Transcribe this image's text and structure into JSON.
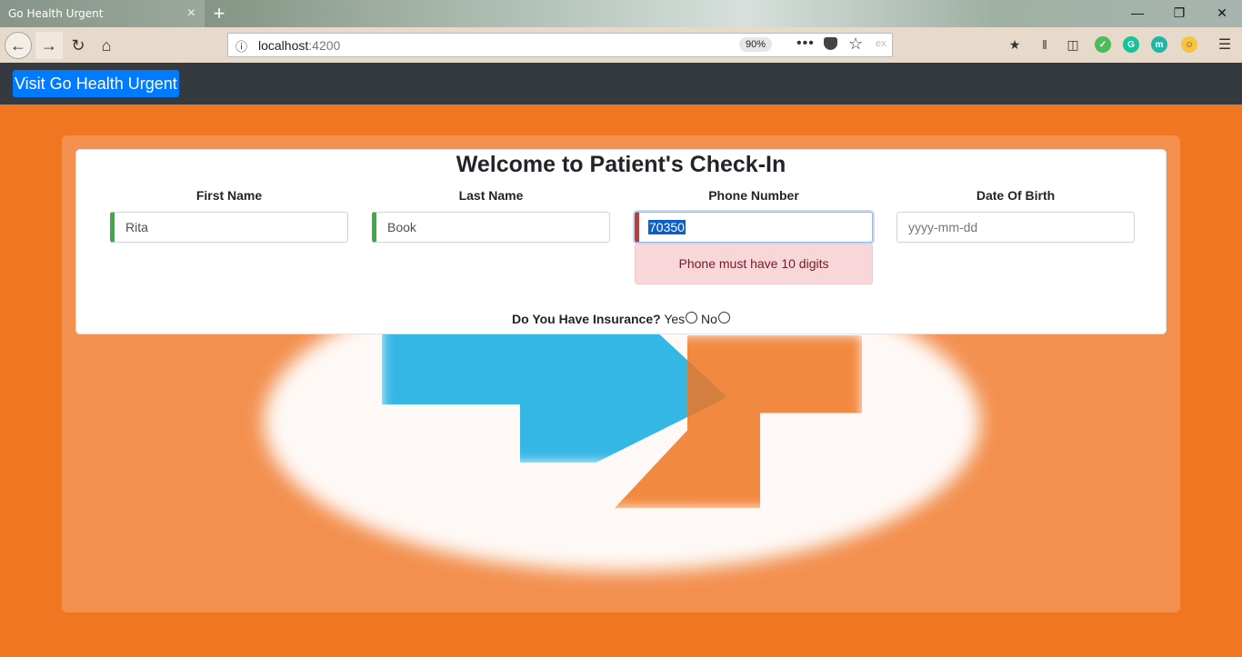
{
  "browser": {
    "tab_title": "Go Health Urgent",
    "tab_close": "×",
    "new_tab": "+",
    "url_host": "localhost",
    "url_port": ":4200",
    "zoom": "90%",
    "page_actions": "•••",
    "ext_text": "ex",
    "window_minimize": "—",
    "window_restore": "❐",
    "window_close": "✕"
  },
  "header": {
    "visit_button": "Visit Go Health Urgent"
  },
  "form": {
    "title": "Welcome to Patient's Check-In",
    "first_name": {
      "label": "First Name",
      "value": "Rita"
    },
    "last_name": {
      "label": "Last Name",
      "value": "Book"
    },
    "phone": {
      "label": "Phone Number",
      "value": "70350",
      "error": "Phone must have 10 digits"
    },
    "dob": {
      "label": "Date Of Birth",
      "placeholder": "yyyy-mm-dd"
    },
    "insurance": {
      "question": "Do You Have Insurance?",
      "yes": "Yes",
      "no": "No"
    }
  },
  "colors": {
    "page_bg": "#f07622",
    "appbar_bg": "#343a40",
    "button_bg": "#007bff",
    "valid_border": "#42a948",
    "invalid_border": "#a94442",
    "alert_bg": "#f8d7da"
  }
}
